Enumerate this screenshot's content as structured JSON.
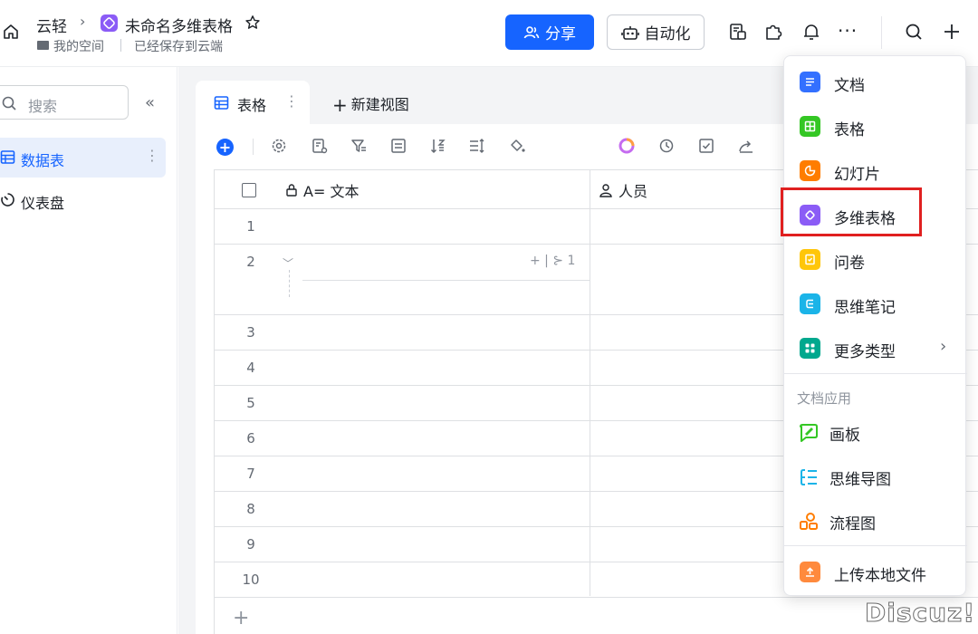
{
  "header": {
    "breadcrumb_root": "云轻",
    "breadcrumb_sep": "›",
    "doc_title": "未命名多维表格",
    "space_label": "我的空间",
    "saved_status": "已经保存到云端",
    "share_label": "分享",
    "automation_label": "自动化",
    "more_label": "···",
    "plus_label": "+"
  },
  "sidebar": {
    "search_placeholder": "搜索",
    "collapse_label": "«",
    "items": [
      {
        "label": "数据表",
        "more": "⋮"
      },
      {
        "label": "仪表盘"
      }
    ]
  },
  "tabs": {
    "active_label": "表格",
    "active_more": "⋮",
    "new_view_plus": "+",
    "new_view_label": "新建视图"
  },
  "toolbar": {
    "add_label": "+"
  },
  "table": {
    "columns": [
      "A= 文本",
      "人员"
    ],
    "rows": [
      "1",
      "2",
      "3",
      "4",
      "5",
      "6",
      "7",
      "8",
      "9",
      "10"
    ],
    "row2_sub": "+ | ⊱ 1",
    "add_row": "+"
  },
  "menu": {
    "items": [
      {
        "label": "文档",
        "color": "#3370ff"
      },
      {
        "label": "表格",
        "color": "#34c724"
      },
      {
        "label": "幻灯片",
        "color": "#ff7d00"
      },
      {
        "label": "多维表格",
        "color": "#8b5cf6"
      },
      {
        "label": "问卷",
        "color": "#ffc60a"
      },
      {
        "label": "思维笔记",
        "color": "#1bb4e8"
      },
      {
        "label": "更多类型",
        "color": "#00a88e",
        "chevron": "›"
      }
    ],
    "group_label": "文档应用",
    "apps": [
      {
        "label": "画板",
        "color": "#34c724"
      },
      {
        "label": "思维导图",
        "color": "#1bb4e8"
      },
      {
        "label": "流程图",
        "color": "#ff7d00"
      }
    ],
    "upload_label": "上传本地文件",
    "upload_color": "#ff8a3d",
    "highlight_color": "#e02020"
  },
  "watermark": "Discuz!"
}
